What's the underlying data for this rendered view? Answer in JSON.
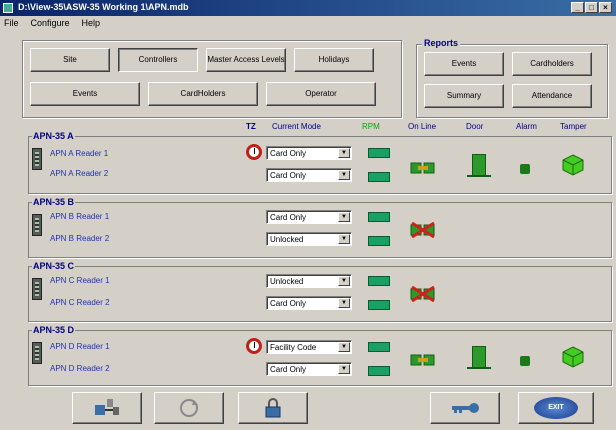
{
  "window": {
    "title": "D:\\View-35\\ASW-35 Working 1\\APN.mdb"
  },
  "menu": [
    "File",
    "Configure",
    "Help"
  ],
  "nav_buttons": {
    "site": "Site",
    "controllers": "Controllers",
    "master_access": "Master Access Levels",
    "holidays": "Holidays",
    "events": "Events",
    "cardholders": "CardHolders",
    "operator": "Operator"
  },
  "reports": {
    "title": "Reports",
    "events": "Events",
    "cardholders": "Cardholders",
    "summary": "Summary",
    "attendance": "Attendance"
  },
  "columns": {
    "tz": "TZ",
    "current_mode": "Current Mode",
    "rpm": "RPM",
    "on_line": "On Line",
    "door": "Door",
    "alarm": "Alarm",
    "tamper": "Tamper"
  },
  "panels": [
    {
      "name": "APN-35 A",
      "readers": [
        {
          "label": "APN A Reader 1",
          "mode": "Card Only",
          "tz": true
        },
        {
          "label": "APN A Reader 2",
          "mode": "Card Only",
          "tz": false
        }
      ],
      "online": true
    },
    {
      "name": "APN-35 B",
      "readers": [
        {
          "label": "APN B Reader 1",
          "mode": "Card Only",
          "tz": false
        },
        {
          "label": "APN B Reader 2",
          "mode": "Unlocked",
          "tz": false
        }
      ],
      "online": false
    },
    {
      "name": "APN-35 C",
      "readers": [
        {
          "label": "APN C Reader 1",
          "mode": "Unlocked",
          "tz": false
        },
        {
          "label": "APN C Reader 2",
          "mode": "Card Only",
          "tz": false
        }
      ],
      "online": false
    },
    {
      "name": "APN-35 D",
      "readers": [
        {
          "label": "APN D Reader 1",
          "mode": "Facility Code",
          "tz": true
        },
        {
          "label": "APN D Reader 2",
          "mode": "Card Only",
          "tz": false
        }
      ],
      "online": true
    }
  ],
  "bottom": {
    "exit": "EXIT"
  },
  "colors": {
    "title_bar": "#0a246a",
    "led_green": "#1aa062",
    "label_blue": "#000080",
    "tz_red": "#c0201a"
  }
}
